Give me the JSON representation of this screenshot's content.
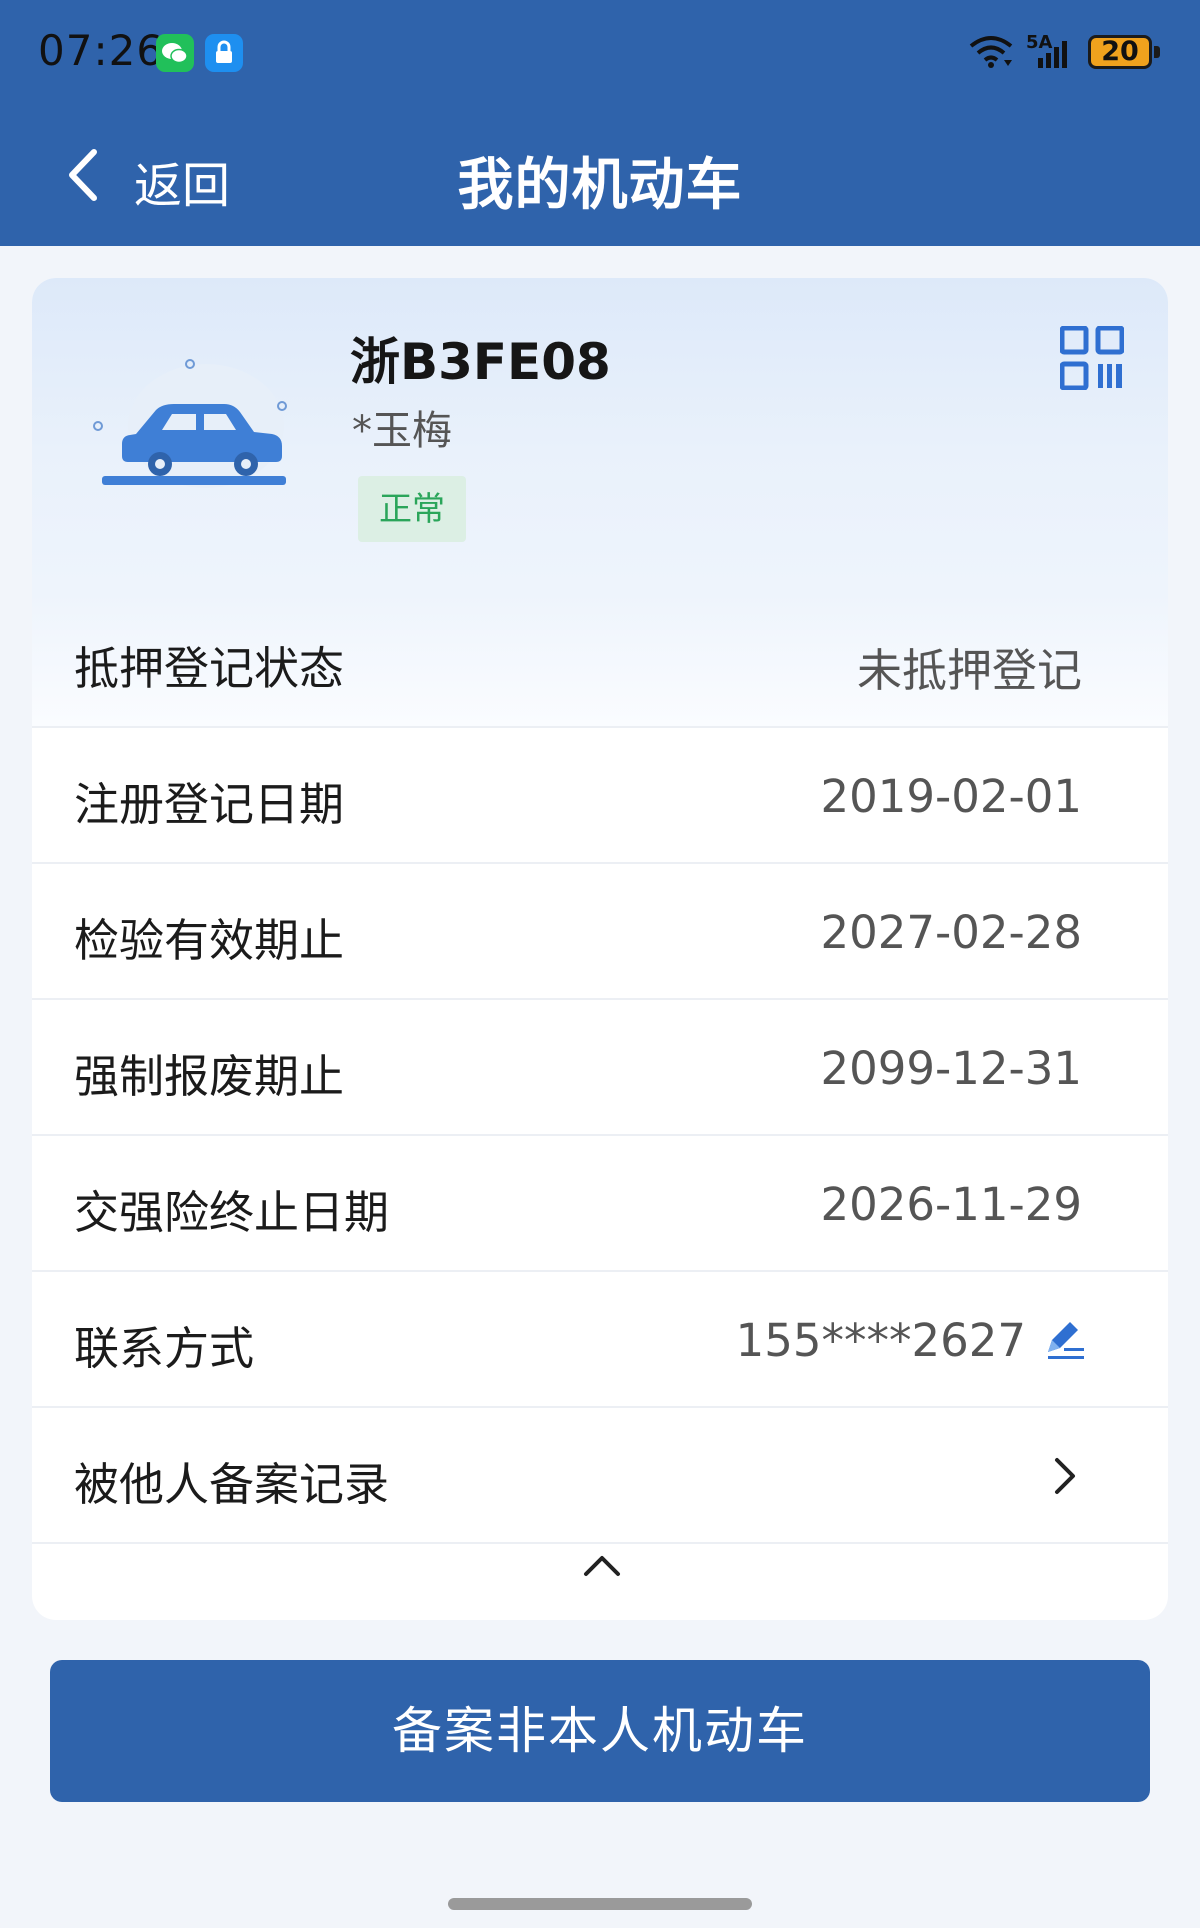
{
  "status_bar": {
    "time": "07:26",
    "battery": "20",
    "network": "5A",
    "icons": [
      "wechat-icon",
      "lock-app-icon",
      "wifi-icon",
      "signal-icon",
      "battery-icon"
    ]
  },
  "nav": {
    "back_label": "返回",
    "title": "我的机动车"
  },
  "vehicle": {
    "plate": "浙B3FE08",
    "owner": "*玉梅",
    "status": "正常"
  },
  "rows": [
    {
      "label": "抵押登记状态",
      "value": "未抵押登记"
    },
    {
      "label": "注册登记日期",
      "value": "2019-02-01"
    },
    {
      "label": "检验有效期止",
      "value": "2027-02-28"
    },
    {
      "label": "强制报废期止",
      "value": "2099-12-31"
    },
    {
      "label": "交强险终止日期",
      "value": "2026-11-29"
    },
    {
      "label": "联系方式",
      "value": "155****2627"
    },
    {
      "label": "被他人备案记录",
      "value": ""
    }
  ],
  "actions": {
    "primary_button": "备案非本人机动车"
  },
  "colors": {
    "brand_blue": "#2f63ab",
    "status_green": "#2aa55a",
    "status_green_bg": "#dcefe4"
  }
}
